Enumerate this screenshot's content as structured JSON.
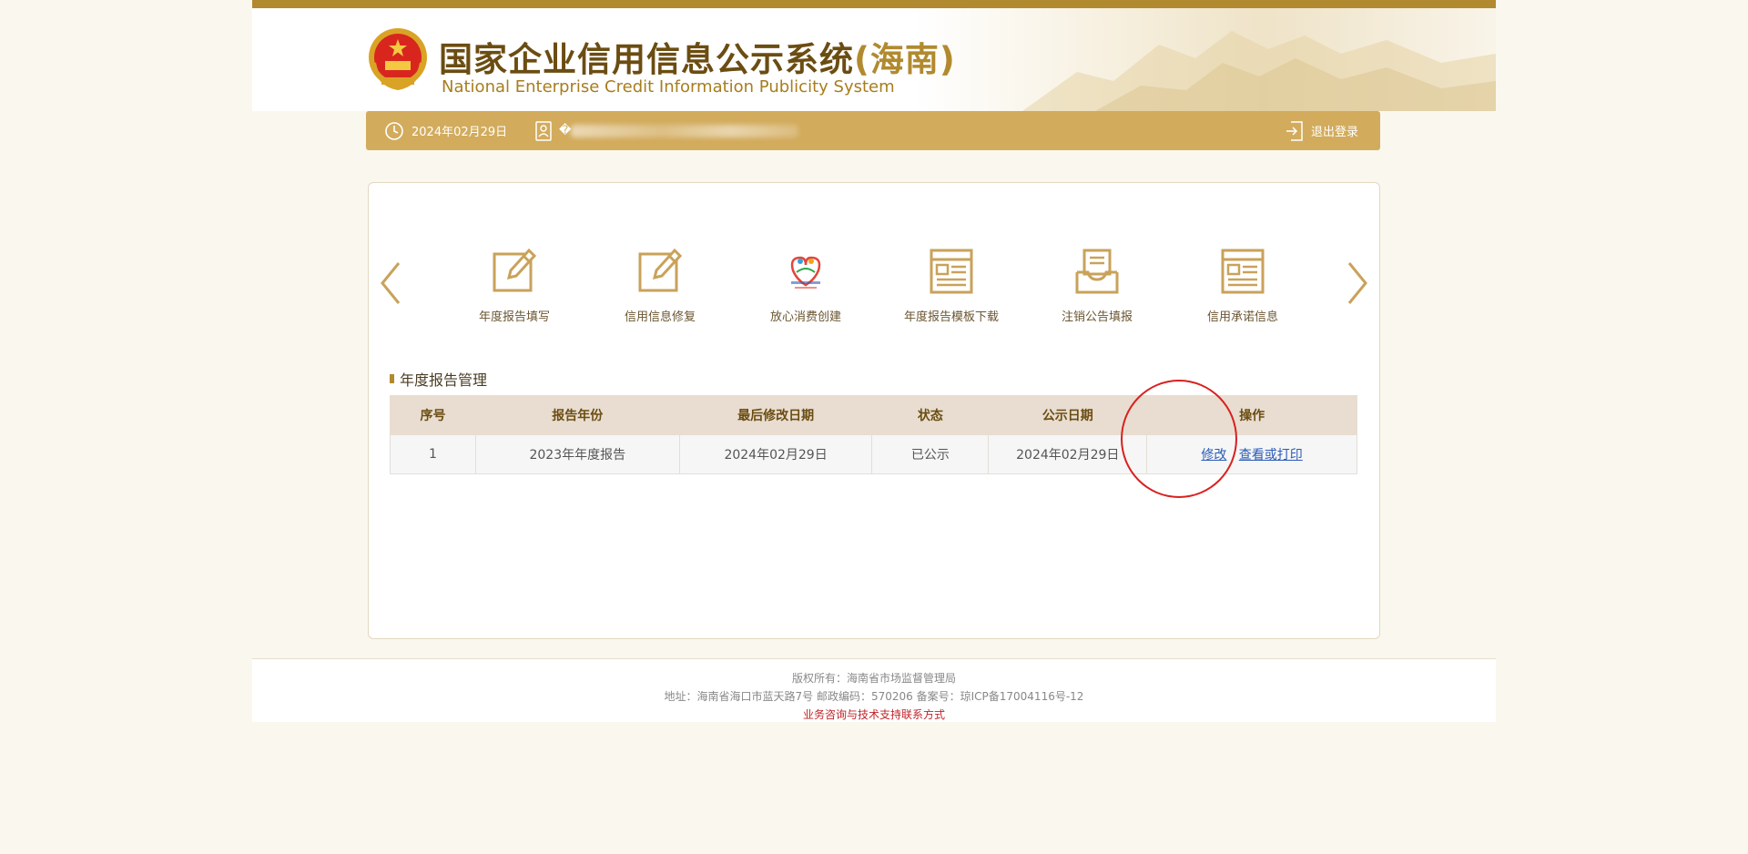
{
  "header": {
    "title_cn": "国家企业信用信息公示系统",
    "title_region": "(海南)",
    "title_en": "National Enterprise Credit Information Publicity System"
  },
  "userbar": {
    "date": "2024年02月29日",
    "user_name_prefix": "�",
    "logout_label": "退出登录"
  },
  "carousel": {
    "items": [
      {
        "label": "年度报告填写",
        "icon": "edit-form-icon"
      },
      {
        "label": "信用信息修复",
        "icon": "edit-form-icon"
      },
      {
        "label": "放心消费创建",
        "icon": "hainan-consumption-logo-icon"
      },
      {
        "label": "年度报告模板下载",
        "icon": "document-list-icon"
      },
      {
        "label": "注销公告填报",
        "icon": "inbox-document-icon"
      },
      {
        "label": "信用承诺信息",
        "icon": "document-list-icon"
      }
    ]
  },
  "section": {
    "title": "年度报告管理"
  },
  "table": {
    "headers": [
      "序号",
      "报告年份",
      "最后修改日期",
      "状态",
      "公示日期",
      "操作"
    ],
    "rows": [
      {
        "index": "1",
        "year": "2023年年度报告",
        "modified": "2024年02月29日",
        "status": "已公示",
        "publish_date": "2024年02月29日",
        "action_edit": "修改",
        "action_view": "查看或打印"
      }
    ]
  },
  "footer": {
    "copyright": "版权所有：海南省市场监督管理局",
    "address": "地址：海南省海口市蓝天路7号 邮政编码：570206 备案号：琼ICP备17004116号-12",
    "contact": "业务咨询与技术支持联系方式"
  },
  "colors": {
    "gold": "#b18a2f",
    "userbar": "#d2ab5c",
    "title_brown": "#6b4d12",
    "link_blue": "#2a5bb5",
    "circle_red": "#d8211f"
  }
}
